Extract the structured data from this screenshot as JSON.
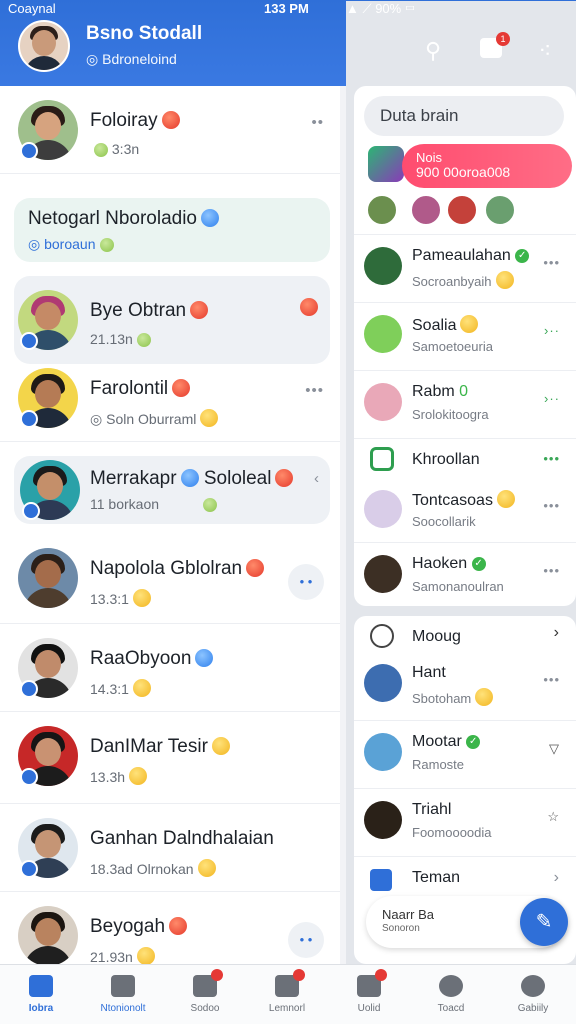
{
  "status_bar": {
    "carrier": "Coaynal",
    "time": "133 PM",
    "battery": "90%"
  },
  "header": {
    "title": "Bsno Stodall",
    "subtitle": "Bdroneloind",
    "badge_count": "1"
  },
  "chats": [
    {
      "name": "Foloiray",
      "sub": "3:3n",
      "action": "more"
    },
    {
      "name": "Netogarl Nboroladio",
      "sub": "boroaun",
      "action": "none",
      "highlight": true
    },
    {
      "name": "Bye Obtran",
      "sub": "21.13n",
      "action": "emoji",
      "highlight": true
    },
    {
      "name": "Farolontil",
      "sub": "Soln Oburraml",
      "action": "more"
    },
    {
      "name": "Merrakapr",
      "name2": "Sololeal",
      "sub": "11 borkaon",
      "action": "chevron",
      "highlight": true
    },
    {
      "name": "Napolola Gblolran",
      "sub": "13.3:1",
      "action": "round"
    },
    {
      "name": "RaaObyoon",
      "sub": "14.3:1",
      "action": "none"
    },
    {
      "name": "DanIMar Tesir",
      "sub": "13.3h",
      "action": "none"
    },
    {
      "name": "Ganhan Dalndhalaian",
      "sub": "18.3ad",
      "sub2": "Olrnokan",
      "action": "none"
    },
    {
      "name": "Beyogah",
      "sub": "21.93n",
      "action": "round"
    }
  ],
  "right_panel": {
    "search_placeholder": "Duta brain",
    "promo_line1": "Nois",
    "promo_line2": "900 00oroa008",
    "contacts": [
      {
        "name": "Pameaulahan",
        "sub": "Socroanbyaih"
      },
      {
        "name": "Soalia",
        "sub": "Samoetoeuria"
      },
      {
        "name": "Rabm",
        "sub": "Srolokitoogra"
      },
      {
        "name": "Khroollan",
        "sub": ""
      },
      {
        "name": "Tontcasoas",
        "sub": "Soocollarik"
      },
      {
        "name": "Haoken",
        "sub": "Samonanoulran"
      }
    ],
    "more_list": [
      {
        "name": "Mooug",
        "sub": ""
      },
      {
        "name": "Hant",
        "sub": "Sbotoham"
      },
      {
        "name": "Mootar",
        "sub": "Ramoste"
      },
      {
        "name": "Triahl",
        "sub": "Foomoooodia"
      },
      {
        "name": "Teman",
        "sub": ""
      }
    ],
    "fab_card_line1": "Naarr Ba",
    "fab_card_line2": "Sonoron"
  },
  "bottom_nav": [
    {
      "label": "Iobra",
      "active": true
    },
    {
      "label": "Ntonionolt",
      "active": false
    },
    {
      "label": "Sodoo",
      "active": false
    },
    {
      "label": "Lemnorl",
      "active": false
    },
    {
      "label": "Uolid",
      "active": false
    },
    {
      "label": "Toacd",
      "active": false
    },
    {
      "label": "Gabiily",
      "active": false
    }
  ],
  "colors": {
    "primary": "#2f6fd8",
    "promo": "#ff4c6f",
    "online": "#3bb54a"
  }
}
